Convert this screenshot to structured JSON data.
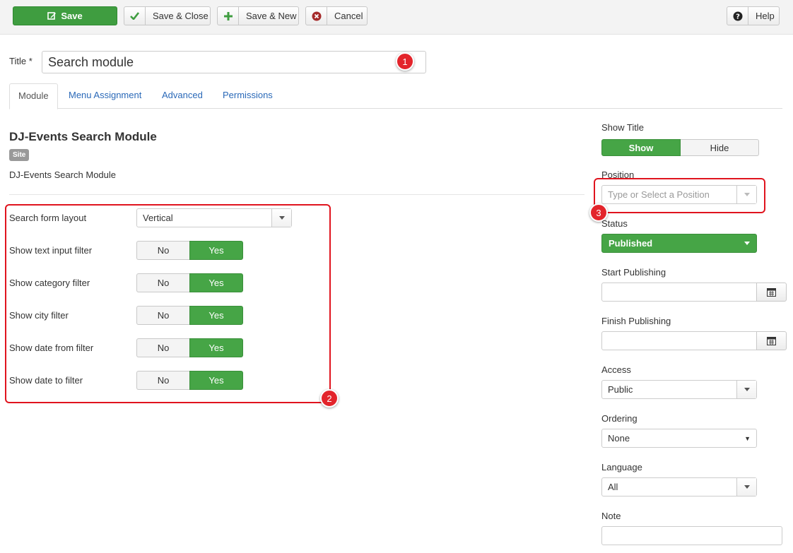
{
  "toolbar": {
    "save": "Save",
    "save_close": "Save & Close",
    "save_new": "Save & New",
    "cancel": "Cancel",
    "help": "Help"
  },
  "title_field": {
    "label": "Title *",
    "value": "Search module"
  },
  "tabs": [
    {
      "label": "Module",
      "active": true
    },
    {
      "label": "Menu Assignment",
      "active": false
    },
    {
      "label": "Advanced",
      "active": false
    },
    {
      "label": "Permissions",
      "active": false
    }
  ],
  "module": {
    "heading": "DJ-Events Search Module",
    "badge": "Site",
    "description": "DJ-Events Search Module"
  },
  "options": {
    "layout_label": "Search form layout",
    "layout_value": "Vertical",
    "toggles": [
      {
        "label": "Show text input filter",
        "no": "No",
        "yes": "Yes"
      },
      {
        "label": "Show category filter",
        "no": "No",
        "yes": "Yes"
      },
      {
        "label": "Show city filter",
        "no": "No",
        "yes": "Yes"
      },
      {
        "label": "Show date from filter",
        "no": "No",
        "yes": "Yes"
      },
      {
        "label": "Show date to filter",
        "no": "No",
        "yes": "Yes"
      }
    ]
  },
  "sidebar": {
    "show_title_label": "Show Title",
    "show": "Show",
    "hide": "Hide",
    "position_label": "Position",
    "position_placeholder": "Type or Select a Position",
    "status_label": "Status",
    "status_value": "Published",
    "start_label": "Start Publishing",
    "finish_label": "Finish Publishing",
    "access_label": "Access",
    "access_value": "Public",
    "ordering_label": "Ordering",
    "ordering_value": "None",
    "language_label": "Language",
    "language_value": "All",
    "note_label": "Note"
  },
  "annotations": {
    "m1": "1",
    "m2": "2",
    "m3": "3"
  },
  "colors": {
    "green": "#46a546",
    "link": "#2a69b8",
    "annotation_red": "#e0141e"
  }
}
